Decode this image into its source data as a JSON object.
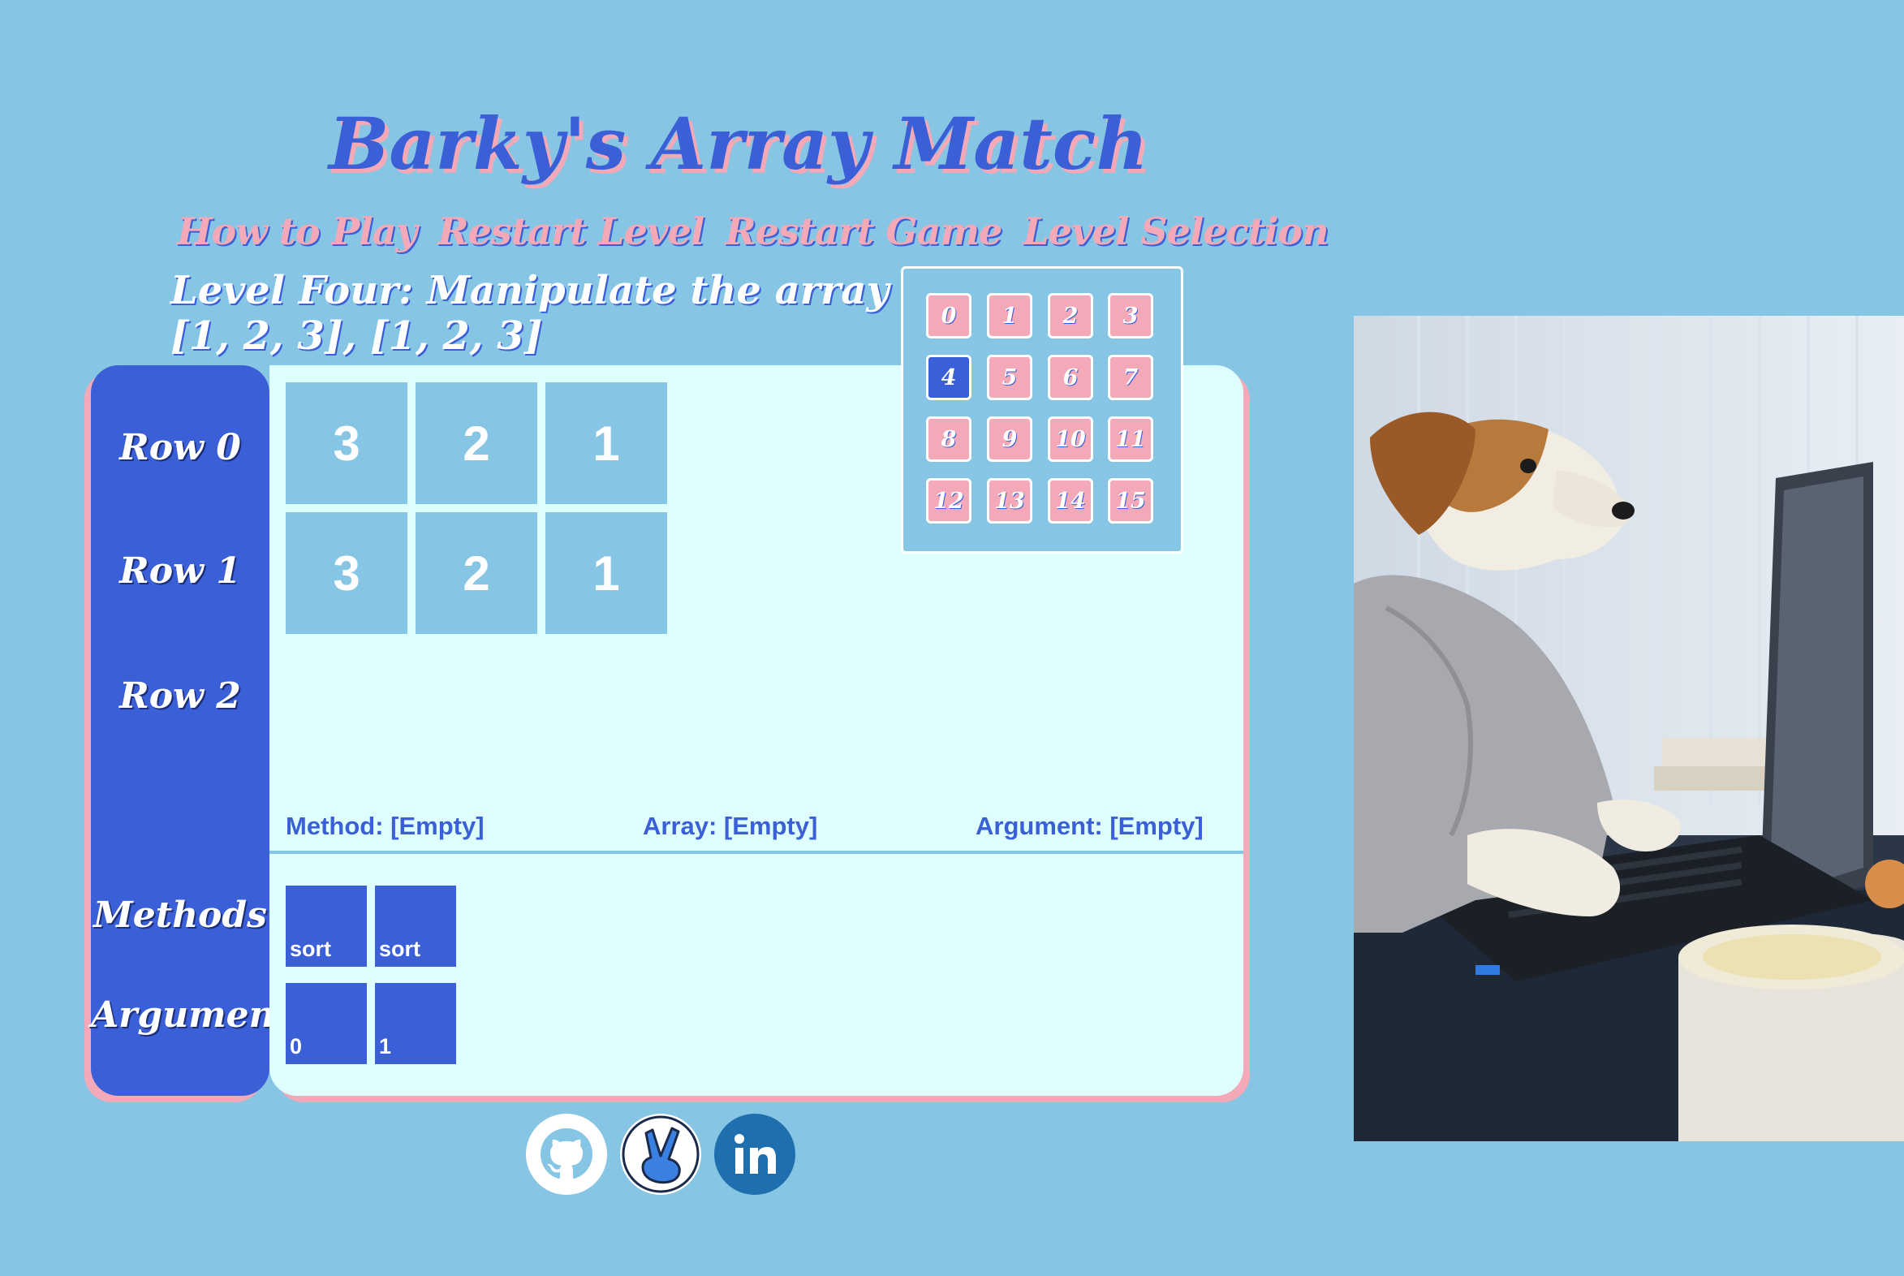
{
  "title": "Barky's Array Match",
  "nav": {
    "how_to_play": "How to Play",
    "restart_level": "Restart Level",
    "restart_game": "Restart Game",
    "level_selection": "Level Selection"
  },
  "level": {
    "instruction": "Level Four: Manipulate the array to match",
    "target": "[1, 2, 3], [1, 2, 3]"
  },
  "rows": {
    "labels": [
      "Row 0",
      "Row 1",
      "Row 2"
    ],
    "row0": [
      "3",
      "2",
      "1"
    ],
    "row1": [
      "3",
      "2",
      "1"
    ],
    "row2": []
  },
  "status": {
    "method": "Method: [Empty]",
    "array": "Array: [Empty]",
    "argument": "Argument: [Empty]"
  },
  "sections": {
    "methods_label": "Methods",
    "arguments_label": "Arguments"
  },
  "methods": [
    "sort",
    "sort"
  ],
  "arguments": [
    "0",
    "1"
  ],
  "level_picker": {
    "levels": [
      "0",
      "1",
      "2",
      "3",
      "4",
      "5",
      "6",
      "7",
      "8",
      "9",
      "10",
      "11",
      "12",
      "13",
      "14",
      "15"
    ],
    "current": "4"
  },
  "social": [
    "github-icon",
    "angellist-icon",
    "linkedin-icon"
  ],
  "colors": {
    "background": "#86c5e4",
    "primary_blue": "#3a5fd6",
    "pink": "#f3a9b7",
    "board": "#dfffff",
    "cell": "#86c5e4"
  }
}
